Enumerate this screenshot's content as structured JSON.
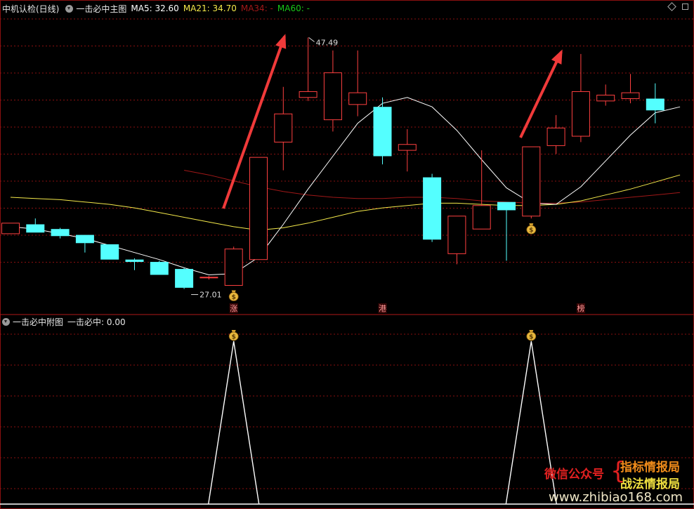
{
  "top_header": {
    "stock_name": "中机认检(日线)",
    "indicator_name": "一击必中主图",
    "ma5": {
      "label": "MA5: 32.60",
      "color": "#ffffff"
    },
    "ma21": {
      "label": "MA21: 34.70",
      "color": "#f4e94a"
    },
    "ma34": {
      "label": "MA34: -",
      "color": "#a01818"
    },
    "ma60": {
      "label": "MA60: -",
      "color": "#18c818"
    }
  },
  "bottom_header": {
    "indicator_name": "一击必中附图",
    "value_label": "一击必中: 0.00"
  },
  "annotations": {
    "high_label": "47.49",
    "low_label": "27.01"
  },
  "markers": [
    {
      "index": 9,
      "char": "涨"
    },
    {
      "index": 15,
      "char": "港"
    },
    {
      "index": 23,
      "char": "榜"
    }
  ],
  "signal_icon": "money-bag-icon",
  "watermark": {
    "left_text": "微信公众号",
    "right_top": "指标情报局",
    "right_bottom": "战法情报局",
    "url": "www.zhibiao168.com"
  },
  "colors": {
    "up": "#ff4040",
    "down": "#54ffff",
    "grid": "#8a1010",
    "ma5": "#ffffff",
    "ma21": "#f4e94a",
    "ma34": "#a01818",
    "arrow": "#f03a3a",
    "signal": "#ffffff"
  },
  "chart_data": {
    "type": "candlestick",
    "candles": [
      {
        "o": 30.8,
        "c": 31.7,
        "h": 31.7,
        "l": 30.8
      },
      {
        "o": 31.6,
        "c": 30.9,
        "h": 32.1,
        "l": 30.9
      },
      {
        "o": 31.2,
        "c": 30.6,
        "h": 31.3,
        "l": 30.4
      },
      {
        "o": 30.7,
        "c": 30.0,
        "h": 30.7,
        "l": 29.2
      },
      {
        "o": 29.9,
        "c": 28.6,
        "h": 29.9,
        "l": 28.6
      },
      {
        "o": 28.6,
        "c": 28.4,
        "h": 28.7,
        "l": 27.7
      },
      {
        "o": 28.4,
        "c": 27.3,
        "h": 28.5,
        "l": 27.3
      },
      {
        "o": 27.8,
        "c": 26.2,
        "h": 27.9,
        "l": 26.1
      },
      {
        "o": 27.1,
        "c": 27.1,
        "h": 27.2,
        "l": 26.9
      },
      {
        "o": 26.4,
        "c": 29.5,
        "h": 29.7,
        "l": 26.4
      },
      {
        "o": 28.6,
        "c": 37.3,
        "h": 37.3,
        "l": 28.6
      },
      {
        "o": 38.6,
        "c": 41.0,
        "h": 43.3,
        "l": 36.2
      },
      {
        "o": 42.4,
        "c": 42.9,
        "h": 47.5,
        "l": 42.1
      },
      {
        "o": 40.5,
        "c": 44.5,
        "h": 46.4,
        "l": 39.5
      },
      {
        "o": 41.8,
        "c": 42.8,
        "h": 46.4,
        "l": 40.8
      },
      {
        "o": 41.6,
        "c": 37.4,
        "h": 42.4,
        "l": 36.7
      },
      {
        "o": 37.9,
        "c": 38.4,
        "h": 39.7,
        "l": 36.1
      },
      {
        "o": 35.6,
        "c": 30.3,
        "h": 35.9,
        "l": 30.1
      },
      {
        "o": 29.1,
        "c": 32.3,
        "h": 32.3,
        "l": 28.2
      },
      {
        "o": 31.2,
        "c": 33.2,
        "h": 37.9,
        "l": 31.2
      },
      {
        "o": 33.5,
        "c": 32.8,
        "h": 33.5,
        "l": 28.5
      },
      {
        "o": 32.3,
        "c": 38.2,
        "h": 38.2,
        "l": 32.1
      },
      {
        "o": 38.3,
        "c": 39.8,
        "h": 40.9,
        "l": 37.6
      },
      {
        "o": 39.1,
        "c": 42.9,
        "h": 46.1,
        "l": 38.6
      },
      {
        "o": 42.1,
        "c": 42.6,
        "h": 43.5,
        "l": 41.7
      },
      {
        "o": 42.3,
        "c": 42.8,
        "h": 44.4,
        "l": 41.9
      },
      {
        "o": 42.3,
        "c": 41.3,
        "h": 43.6,
        "l": 40.2
      }
    ],
    "ma5": [
      31.4,
      31.2,
      30.8,
      30.4,
      29.8,
      29.2,
      28.6,
      27.9,
      27.3,
      27.4,
      28.8,
      31.6,
      34.6,
      37.4,
      40.2,
      41.9,
      42.4,
      41.6,
      39.6,
      37.1,
      34.7,
      33.4,
      33.3,
      34.8,
      37.0,
      39.2,
      41.1,
      41.6
    ],
    "ma21": [
      33.9,
      33.8,
      33.7,
      33.5,
      33.3,
      33.0,
      32.6,
      32.2,
      31.8,
      31.4,
      31.1,
      31.3,
      31.7,
      32.2,
      32.7,
      33.0,
      33.2,
      33.4,
      33.4,
      33.3,
      33.2,
      33.2,
      33.3,
      33.6,
      34.1,
      34.6,
      35.2,
      35.8
    ],
    "ma34": [
      null,
      null,
      null,
      null,
      null,
      null,
      null,
      36.2,
      35.8,
      35.3,
      34.8,
      34.4,
      34.1,
      33.9,
      33.8,
      33.8,
      33.9,
      33.9,
      33.8,
      33.6,
      33.5,
      33.4,
      33.4,
      33.5,
      33.7,
      33.9,
      34.1,
      34.3
    ],
    "signals": [
      9,
      21
    ]
  }
}
